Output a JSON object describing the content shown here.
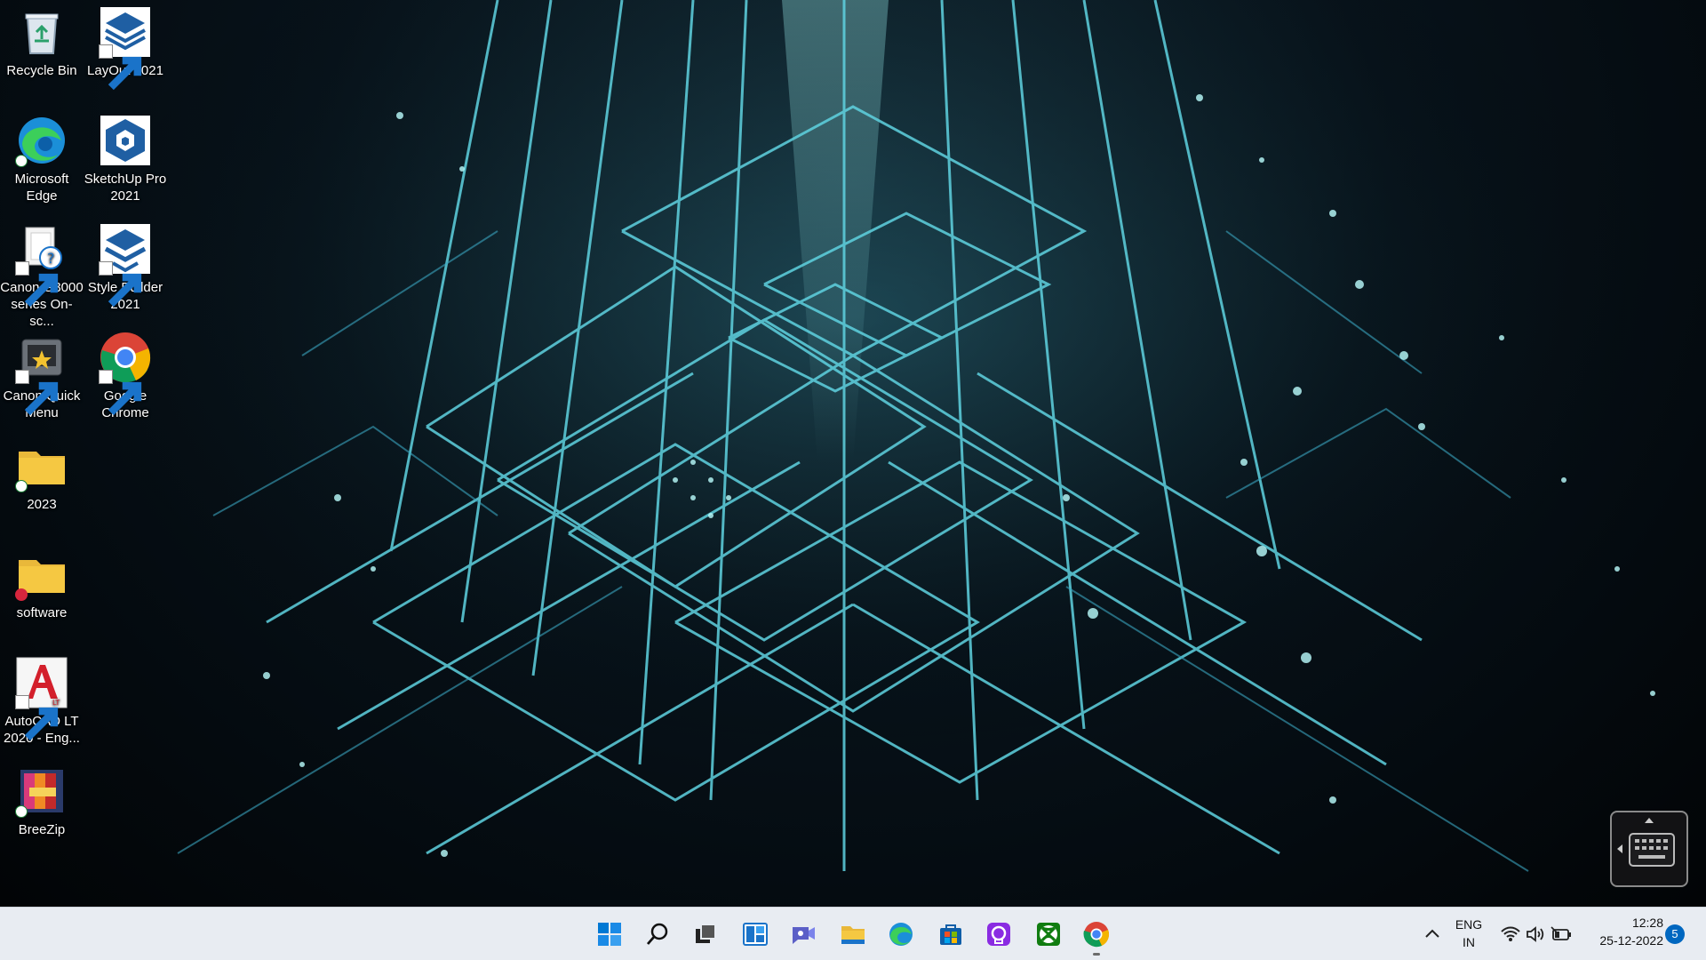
{
  "desktop": {
    "icons": [
      {
        "label": "Recycle Bin",
        "icon": "recycle-bin-icon"
      },
      {
        "label": "LayOut 2021",
        "icon": "layout-icon"
      },
      {
        "label": "Microsoft Edge",
        "icon": "edge-icon"
      },
      {
        "label": "SketchUp Pro 2021",
        "icon": "sketchup-icon"
      },
      {
        "label": "Canon G3000 series On-sc...",
        "icon": "canon-manual-icon"
      },
      {
        "label": "Style Builder 2021",
        "icon": "style-builder-icon"
      },
      {
        "label": "Canon Quick Menu",
        "icon": "canon-quick-menu-icon"
      },
      {
        "label": "Google Chrome",
        "icon": "chrome-icon"
      },
      {
        "label": "2023",
        "icon": "folder-icon"
      },
      {
        "label": "software",
        "icon": "folder-icon"
      },
      {
        "label": "AutoCAD LT 2020 - Eng...",
        "icon": "autocad-icon"
      },
      {
        "label": "BreeZip",
        "icon": "breezip-icon"
      }
    ]
  },
  "taskbar": {
    "apps": [
      {
        "name": "Start",
        "icon": "windows-start-icon"
      },
      {
        "name": "Search",
        "icon": "search-icon"
      },
      {
        "name": "Task View",
        "icon": "task-view-icon"
      },
      {
        "name": "Widgets",
        "icon": "widgets-icon"
      },
      {
        "name": "Chat",
        "icon": "chat-icon"
      },
      {
        "name": "File Explorer",
        "icon": "file-explorer-icon"
      },
      {
        "name": "Microsoft Edge",
        "icon": "edge-icon"
      },
      {
        "name": "Microsoft Store",
        "icon": "store-icon"
      },
      {
        "name": "Proton",
        "icon": "purple-app-icon"
      },
      {
        "name": "Xbox",
        "icon": "xbox-icon"
      },
      {
        "name": "Google Chrome",
        "icon": "chrome-icon"
      }
    ],
    "tray": {
      "language_line1": "ENG",
      "language_line2": "IN",
      "time": "12:28",
      "date": "25-12-2022",
      "notification_count": "5"
    }
  },
  "colors": {
    "taskbar_bg": "#e8ecf2",
    "accent": "#0067c0",
    "folder": "#f5c842"
  }
}
